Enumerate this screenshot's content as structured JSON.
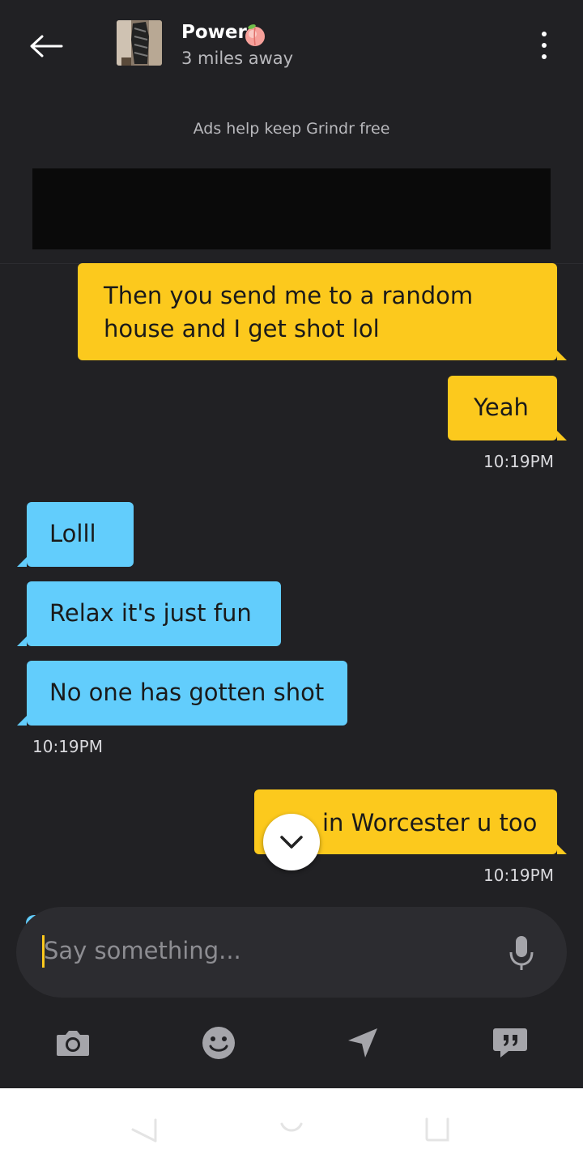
{
  "header": {
    "back_icon": "arrow-left-icon",
    "profile_name": "Power",
    "name_emoji": "peach-icon",
    "distance": "3 miles away",
    "menu_icon": "more-vertical-icon"
  },
  "ads": {
    "notice": "Ads help keep Grindr free"
  },
  "messages": [
    {
      "direction": "out",
      "text_line1": "Then you send me to a random",
      "text_line2": "house and I get shot lol"
    },
    {
      "direction": "out",
      "text": "Yeah",
      "time": "10:19PM"
    },
    {
      "direction": "in",
      "text": "Lolll"
    },
    {
      "direction": "in",
      "text": "Relax it's just fun"
    },
    {
      "direction": "in",
      "text": "No one has gotten shot",
      "time": "10:19PM"
    },
    {
      "direction": "out",
      "text": "in Worcester u too",
      "time": "10:19PM"
    }
  ],
  "composer": {
    "placeholder": "Say something...",
    "mic_icon": "microphone-icon"
  },
  "toolbar": {
    "items": [
      "camera-icon",
      "emoji-icon",
      "location-icon",
      "saved-phrases-icon"
    ]
  },
  "colors": {
    "background": "#212124",
    "outgoing_bubble": "#fcc91d",
    "incoming_bubble": "#62cdfc",
    "accent": "#fcc91d"
  }
}
